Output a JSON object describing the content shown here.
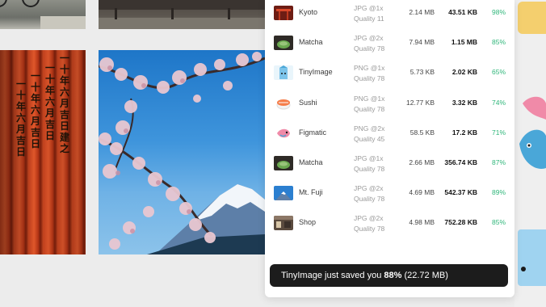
{
  "gallery": {
    "torii_kanji": [
      "一",
      "十",
      "年",
      "六",
      "月",
      "吉",
      "日",
      "建",
      "之"
    ]
  },
  "results": {
    "rows": [
      {
        "name": "Kyoto",
        "format": "JPG @1x",
        "quality": "Quality 11",
        "original": "2.14 MB",
        "optimized": "43.51 KB",
        "saved": "98%",
        "thumb": "kyoto-thumbnail"
      },
      {
        "name": "Matcha",
        "format": "JPG @2x",
        "quality": "Quality 78",
        "original": "7.94 MB",
        "optimized": "1.15 MB",
        "saved": "85%",
        "thumb": "matcha-thumbnail"
      },
      {
        "name": "TinyImage",
        "format": "PNG @1x",
        "quality": "Quality 78",
        "original": "5.73 KB",
        "optimized": "2.02 KB",
        "saved": "65%",
        "thumb": "milk-carton-thumbnail"
      },
      {
        "name": "Sushi",
        "format": "PNG @1x",
        "quality": "Quality 78",
        "original": "12.77 KB",
        "optimized": "3.32 KB",
        "saved": "74%",
        "thumb": "sushi-thumbnail"
      },
      {
        "name": "Figmatic",
        "format": "PNG @2x",
        "quality": "Quality 45",
        "original": "58.5 KB",
        "optimized": "17.2 KB",
        "saved": "71%",
        "thumb": "koi-thumbnail"
      },
      {
        "name": "Matcha",
        "format": "JPG @1x",
        "quality": "Quality 78",
        "original": "2.66 MB",
        "optimized": "356.74 KB",
        "saved": "87%",
        "thumb": "matcha-thumbnail"
      },
      {
        "name": "Mt. Fuji",
        "format": "JPG @2x",
        "quality": "Quality 78",
        "original": "4.69 MB",
        "optimized": "542.37 KB",
        "saved": "89%",
        "thumb": "fuji-thumbnail"
      },
      {
        "name": "Shop",
        "format": "JPG @2x",
        "quality": "Quality 78",
        "original": "4.98 MB",
        "optimized": "752.28 KB",
        "saved": "85%",
        "thumb": "shop-thumbnail"
      }
    ]
  },
  "toast": {
    "prefix": "TinyImage just saved you ",
    "percent": "88%",
    "suffix": " (22.72 MB)"
  },
  "colors": {
    "saved_green": "#2fb67a",
    "toast_bg": "#1c1c1c",
    "panel_bg": "#ffffff"
  }
}
